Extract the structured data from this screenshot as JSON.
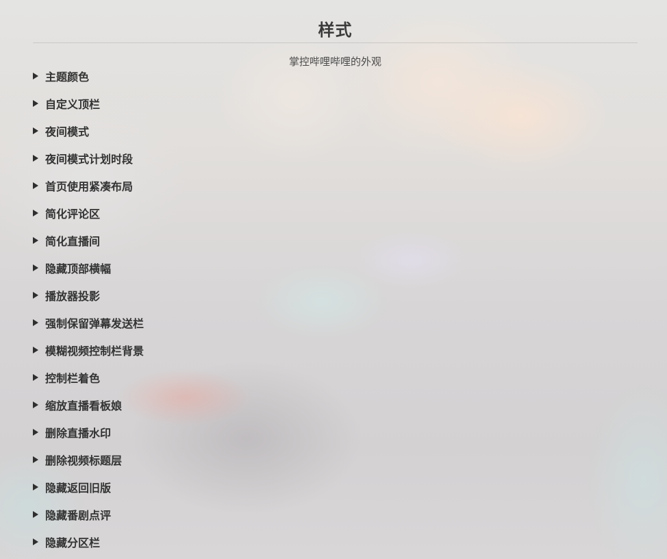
{
  "section": {
    "title": "样式",
    "subtitle": "掌控哔哩哔哩的外观"
  },
  "items": [
    {
      "label": "主题颜色"
    },
    {
      "label": "自定义顶栏"
    },
    {
      "label": "夜间模式"
    },
    {
      "label": "夜间模式计划时段"
    },
    {
      "label": "首页使用紧凑布局"
    },
    {
      "label": "简化评论区"
    },
    {
      "label": "简化直播间"
    },
    {
      "label": "隐藏顶部横幅"
    },
    {
      "label": "播放器投影"
    },
    {
      "label": "强制保留弹幕发送栏"
    },
    {
      "label": "模糊视频控制栏背景"
    },
    {
      "label": "控制栏着色"
    },
    {
      "label": "缩放直播看板娘"
    },
    {
      "label": "删除直播水印"
    },
    {
      "label": "删除视频标题层"
    },
    {
      "label": "隐藏返回旧版"
    },
    {
      "label": "隐藏番剧点评"
    },
    {
      "label": "隐藏分区栏"
    }
  ],
  "icons": {
    "expand": "triangle-right-icon"
  }
}
